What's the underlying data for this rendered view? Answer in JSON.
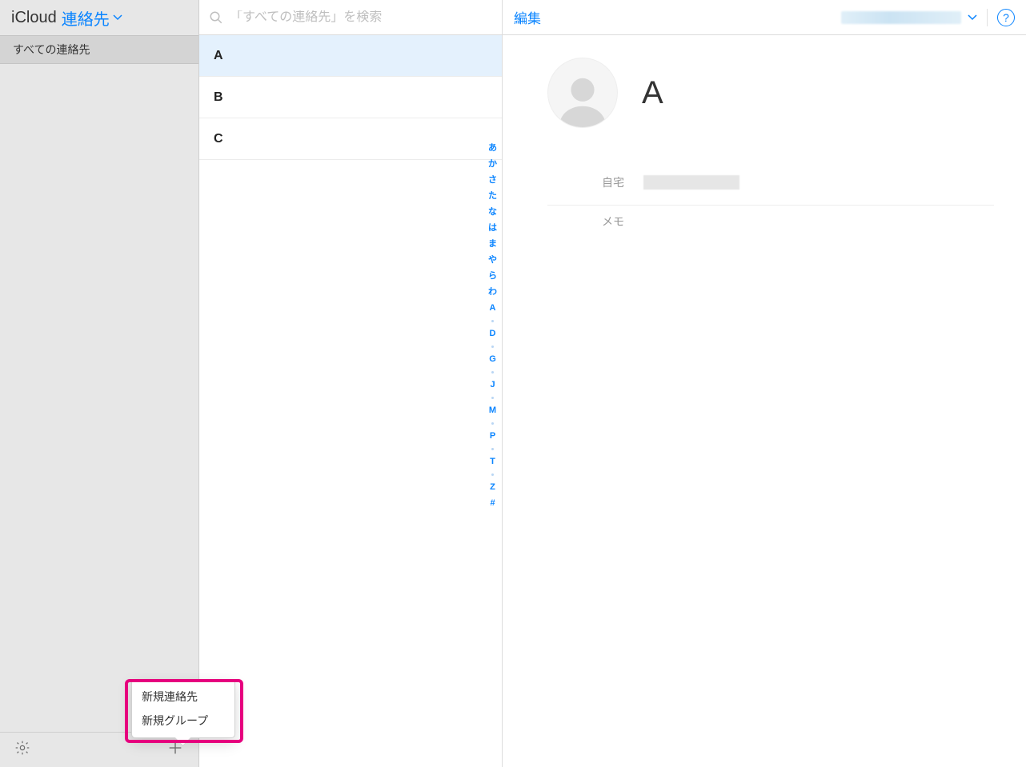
{
  "sidebar": {
    "app_label": "iCloud",
    "section_label": "連絡先",
    "group_all": "すべての連絡先",
    "popup": {
      "new_contact": "新規連絡先",
      "new_group": "新規グループ"
    }
  },
  "list": {
    "search_placeholder": "「すべての連絡先」を検索",
    "items": [
      "A",
      "B",
      "C"
    ],
    "index": [
      "あ",
      "か",
      "さ",
      "た",
      "な",
      "は",
      "ま",
      "や",
      "ら",
      "わ",
      "A",
      "·",
      "D",
      "·",
      "G",
      "·",
      "J",
      "·",
      "M",
      "·",
      "P",
      "·",
      "T",
      "·",
      "Z",
      "#"
    ]
  },
  "detail": {
    "edit_label": "編集",
    "name": "A",
    "fields": {
      "home_label": "自宅",
      "memo_label": "メモ"
    }
  }
}
